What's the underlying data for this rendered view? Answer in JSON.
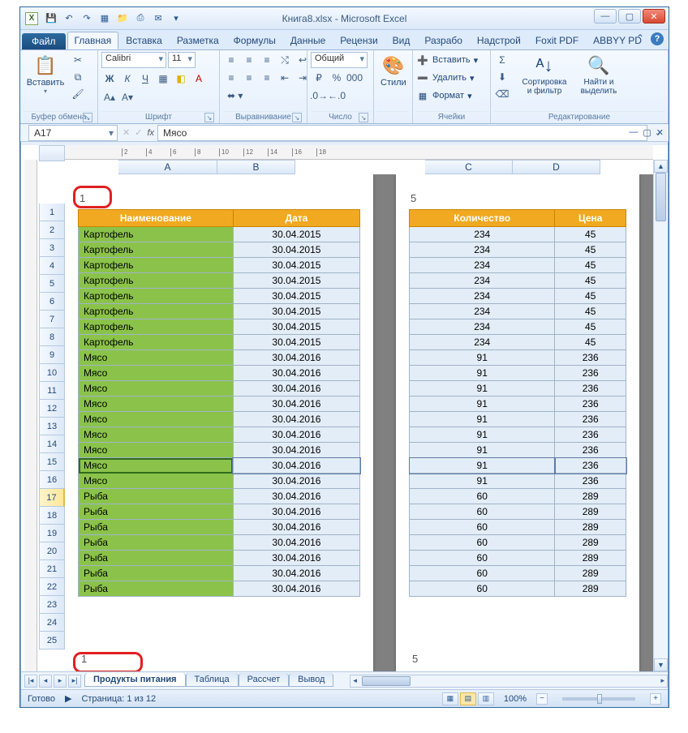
{
  "app": {
    "title": "Книга8.xlsx - Microsoft Excel"
  },
  "qat": {
    "save": "💾",
    "undo": "↶",
    "redo": "↷",
    "new": "▦",
    "open": "📁",
    "quick": "⎙",
    "mail": "✉"
  },
  "tabs": {
    "file": "Файл",
    "items": [
      "Главная",
      "Вставка",
      "Разметка",
      "Формулы",
      "Данные",
      "Рецензи",
      "Вид",
      "Разрабо",
      "Надстрой",
      "Foxit PDF",
      "ABBYY PD"
    ],
    "active_index": 0
  },
  "ribbon": {
    "clipboard": {
      "label": "Буфер обмена",
      "paste": "Вставить"
    },
    "font": {
      "label": "Шрифт",
      "name": "Calibri",
      "size": "11"
    },
    "alignment": {
      "label": "Выравнивание"
    },
    "number": {
      "label": "Число",
      "format": "Общий"
    },
    "styles": {
      "label": "Стили",
      "styles_btn": "Стили"
    },
    "cells": {
      "label": "Ячейки",
      "insert": "Вставить",
      "delete": "Удалить",
      "format": "Формат"
    },
    "editing": {
      "label": "Редактирование",
      "sort": "Сортировка и фильтр",
      "find": "Найти и выделить"
    }
  },
  "formula_bar": {
    "name_box": "A17",
    "fx": "fx",
    "value": "Мясо"
  },
  "columns": {
    "left": [
      "A",
      "B"
    ],
    "right": [
      "C",
      "D"
    ]
  },
  "row_numbers": [
    1,
    2,
    3,
    4,
    5,
    6,
    7,
    8,
    9,
    10,
    11,
    12,
    13,
    14,
    15,
    16,
    17,
    18,
    19,
    20,
    21,
    22,
    23,
    24,
    25
  ],
  "selected_row": 17,
  "ruler_ticks": [
    2,
    4,
    6,
    8,
    10,
    12,
    14,
    16,
    18
  ],
  "page_left": {
    "page_no_top": "1",
    "page_no_bottom": "1",
    "headers": [
      "Наименование",
      "Дата"
    ],
    "rows": [
      [
        "Картофель",
        "30.04.2015"
      ],
      [
        "Картофель",
        "30.04.2015"
      ],
      [
        "Картофель",
        "30.04.2015"
      ],
      [
        "Картофель",
        "30.04.2015"
      ],
      [
        "Картофель",
        "30.04.2015"
      ],
      [
        "Картофель",
        "30.04.2015"
      ],
      [
        "Картофель",
        "30.04.2015"
      ],
      [
        "Картофель",
        "30.04.2015"
      ],
      [
        "Мясо",
        "30.04.2016"
      ],
      [
        "Мясо",
        "30.04.2016"
      ],
      [
        "Мясо",
        "30.04.2016"
      ],
      [
        "Мясо",
        "30.04.2016"
      ],
      [
        "Мясо",
        "30.04.2016"
      ],
      [
        "Мясо",
        "30.04.2016"
      ],
      [
        "Мясо",
        "30.04.2016"
      ],
      [
        "Мясо",
        "30.04.2016"
      ],
      [
        "Мясо",
        "30.04.2016"
      ],
      [
        "Рыба",
        "30.04.2016"
      ],
      [
        "Рыба",
        "30.04.2016"
      ],
      [
        "Рыба",
        "30.04.2016"
      ],
      [
        "Рыба",
        "30.04.2016"
      ],
      [
        "Рыба",
        "30.04.2016"
      ],
      [
        "Рыба",
        "30.04.2016"
      ],
      [
        "Рыба",
        "30.04.2016"
      ]
    ]
  },
  "page_right": {
    "page_no_top": "5",
    "page_no_bottom": "5",
    "headers": [
      "Количество",
      "Цена"
    ],
    "rows": [
      [
        "234",
        "45"
      ],
      [
        "234",
        "45"
      ],
      [
        "234",
        "45"
      ],
      [
        "234",
        "45"
      ],
      [
        "234",
        "45"
      ],
      [
        "234",
        "45"
      ],
      [
        "234",
        "45"
      ],
      [
        "234",
        "45"
      ],
      [
        "91",
        "236"
      ],
      [
        "91",
        "236"
      ],
      [
        "91",
        "236"
      ],
      [
        "91",
        "236"
      ],
      [
        "91",
        "236"
      ],
      [
        "91",
        "236"
      ],
      [
        "91",
        "236"
      ],
      [
        "91",
        "236"
      ],
      [
        "91",
        "236"
      ],
      [
        "60",
        "289"
      ],
      [
        "60",
        "289"
      ],
      [
        "60",
        "289"
      ],
      [
        "60",
        "289"
      ],
      [
        "60",
        "289"
      ],
      [
        "60",
        "289"
      ],
      [
        "60",
        "289"
      ]
    ]
  },
  "sheets": {
    "items": [
      "Продукты питания",
      "Таблица",
      "Рассчет",
      "Вывод"
    ],
    "active_index": 0
  },
  "status": {
    "mode": "Готово",
    "page": "Страница: 1 из 12",
    "zoom": "100%"
  }
}
